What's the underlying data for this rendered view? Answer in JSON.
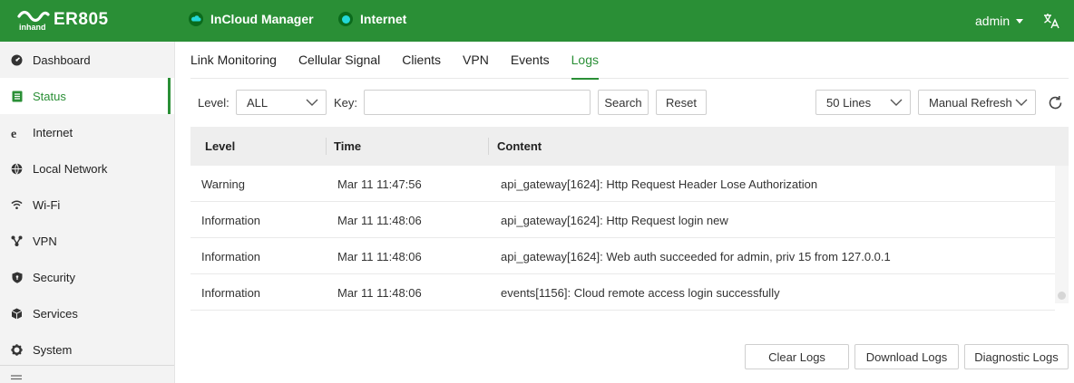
{
  "header": {
    "logo_text": "inhand",
    "model": "ER805",
    "incloud_label": "InCloud Manager",
    "internet_label": "Internet",
    "user": "admin",
    "language_icon": "translate-icon",
    "colors": {
      "brand": "#2a8f36",
      "internet_status": "#23d8d8"
    }
  },
  "sidebar": {
    "items": [
      {
        "label": "Dashboard",
        "icon": "dashboard-icon"
      },
      {
        "label": "Status",
        "icon": "status-icon",
        "active": true
      },
      {
        "label": "Internet",
        "icon": "internet-icon"
      },
      {
        "label": "Local Network",
        "icon": "globe-icon"
      },
      {
        "label": "Wi-Fi",
        "icon": "wifi-icon"
      },
      {
        "label": "VPN",
        "icon": "vpn-icon"
      },
      {
        "label": "Security",
        "icon": "shield-icon"
      },
      {
        "label": "Services",
        "icon": "cube-icon"
      },
      {
        "label": "System",
        "icon": "gear-icon"
      }
    ]
  },
  "tabs": [
    "Link Monitoring",
    "Cellular Signal",
    "Clients",
    "VPN",
    "Events",
    "Logs"
  ],
  "active_tab": "Logs",
  "filters": {
    "level_label": "Level:",
    "level_value": "ALL",
    "key_label": "Key:",
    "key_value": "",
    "search_label": "Search",
    "reset_label": "Reset",
    "lines_value": "50 Lines",
    "refresh_mode": "Manual Refresh"
  },
  "table": {
    "columns": [
      "Level",
      "Time",
      "Content"
    ],
    "rows": [
      {
        "level": "Warning",
        "time": "Mar 11 11:47:56",
        "content": "api_gateway[1624]: Http Request Header Lose Authorization"
      },
      {
        "level": "Information",
        "time": "Mar 11 11:48:06",
        "content": "api_gateway[1624]: Http Request login new"
      },
      {
        "level": "Information",
        "time": "Mar 11 11:48:06",
        "content": "api_gateway[1624]: Web auth succeeded for admin, priv 15 from 127.0.0.1"
      },
      {
        "level": "Information",
        "time": "Mar 11 11:48:06",
        "content": "events[1156]: Cloud remote access login successfully"
      }
    ]
  },
  "actions": {
    "clear_label": "Clear Logs",
    "download_label": "Download Logs",
    "diagnostic_label": "Diagnostic Logs"
  }
}
